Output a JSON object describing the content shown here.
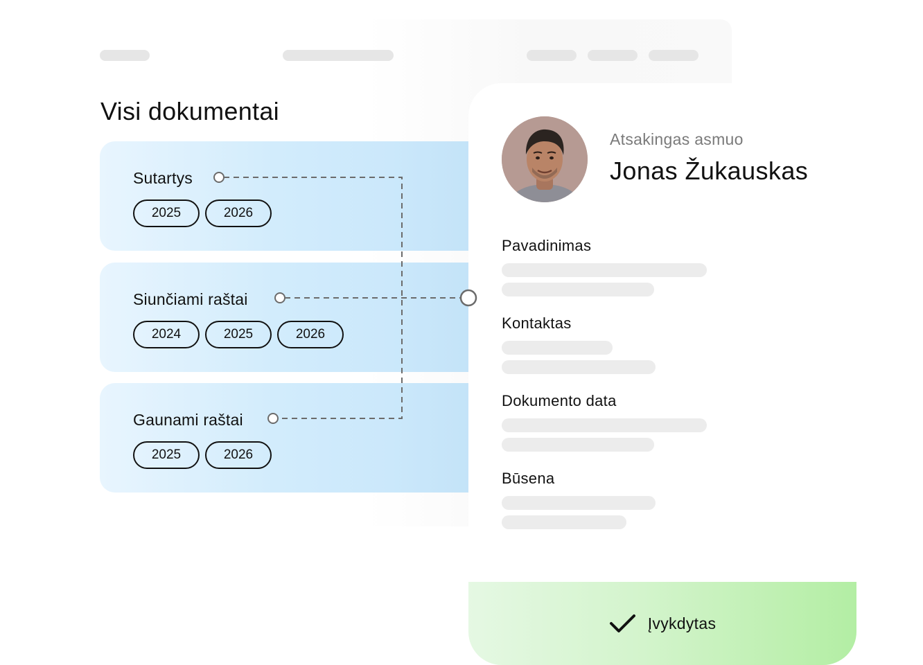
{
  "page": {
    "title": "Visi dokumentai"
  },
  "categories": [
    {
      "label": "Sutartys",
      "years": [
        "2025",
        "2026"
      ]
    },
    {
      "label": "Siunčiami raštai",
      "years": [
        "2024",
        "2025",
        "2026"
      ]
    },
    {
      "label": "Gaunami raštai",
      "years": [
        "2025",
        "2026"
      ]
    }
  ],
  "detail": {
    "role_label": "Atsakingas asmuo",
    "person_name": "Jonas Žukauskas",
    "fields": [
      {
        "label": "Pavadinimas"
      },
      {
        "label": "Kontaktas"
      },
      {
        "label": "Dokumento data"
      },
      {
        "label": "Būsena"
      }
    ]
  },
  "status": {
    "label": "Įvykdytas",
    "icon": "check-icon",
    "color": "#b3eea4"
  },
  "colors": {
    "card_blue": "#cbe8fb",
    "skeleton": "#e6e6e6",
    "connector": "#6b6b6b"
  }
}
